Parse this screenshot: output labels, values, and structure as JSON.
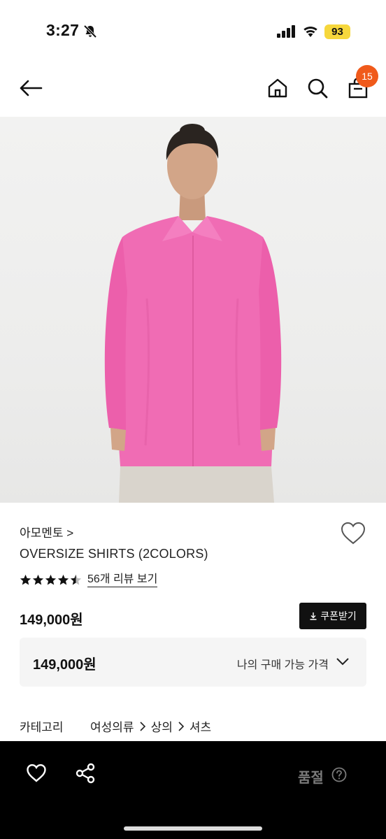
{
  "status_bar": {
    "time": "3:27",
    "battery": "93"
  },
  "nav": {
    "cart_count": "15"
  },
  "product": {
    "brand": "아모멘토 >",
    "title": "OVERSIZE SHIRTS (2COLORS)",
    "rating_stars": 4.5,
    "review_link": "56개 리뷰 보기",
    "price": "149,000원",
    "coupon_label": "쿠폰받기",
    "my_price_value": "149,000원",
    "my_price_label": "나의 구매 가능 가격",
    "category_label": "카테고리",
    "category_path": [
      "여성의류",
      "상의",
      "셔츠"
    ]
  },
  "bottom_bar": {
    "soldout_label": "품절"
  },
  "colors": {
    "badge": "#f05a1b",
    "battery": "#f6d73c",
    "shirt": "#f06cb4"
  }
}
